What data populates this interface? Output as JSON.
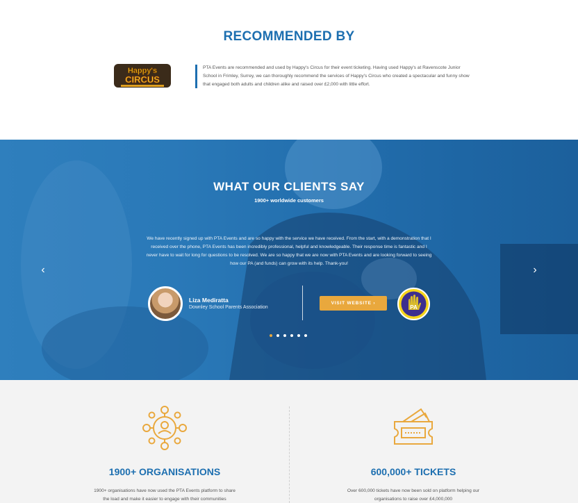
{
  "recommended": {
    "title": "RECOMMENDED BY",
    "logo_text": "Happy's Circus",
    "text": "PTA Events are recommended and used by Happy's Circus for their event ticketing. Having used Happy's at Ravenscote Junior School in Frimley, Surrey, we can thoroughly recommend the services of Happy's Circus who created a spectacular and funny show that engaged both adults and children alike and raised over £2,000 with little effort."
  },
  "testimonials": {
    "title_light": "WHAT OUR ",
    "title_bold": "CLIENTS SAY",
    "subtitle": "1900+ worldwide customers",
    "quote": "We have recently signed up with PTA Events and are so happy with the service we have received. From the start, with a demonstration that I received over the phone, PTA Events has been incredibly professional, helpful and knowledgeable. Their response time is fantastic and I never have to wait for long for questions to be resolved. We are so happy that we are now with PTA Events and are looking forward to seeing how our PA (and funds) can grow with its help. Thank-you!",
    "person_name": "Liza Mediratta",
    "person_org": "Downley School Parents Association",
    "visit_label": "VISIT WEBSITE  ›",
    "client_logo_text": "PA",
    "prev_icon": "chevron-left-icon",
    "next_icon": "chevron-right-icon",
    "prev_label": "‹",
    "next_label": "›",
    "slide_count": 6,
    "active_slide": 1
  },
  "stats": [
    {
      "icon": "network-user-icon",
      "title": "1900+ ORGANISATIONS",
      "text": "1900+ organisations have now used the PTA Events platform to share the load and make it easier to engage with their communities"
    },
    {
      "icon": "ticket-icon",
      "title": "600,000+ TICKETS",
      "text": "Over 600,000 tickets have now been sold on platform helping our organisations to raise over £4,000,000"
    }
  ],
  "colors": {
    "brand_blue": "#1d6fb0",
    "accent_orange": "#e9a83d",
    "stats_bg": "#f3f3f3"
  }
}
